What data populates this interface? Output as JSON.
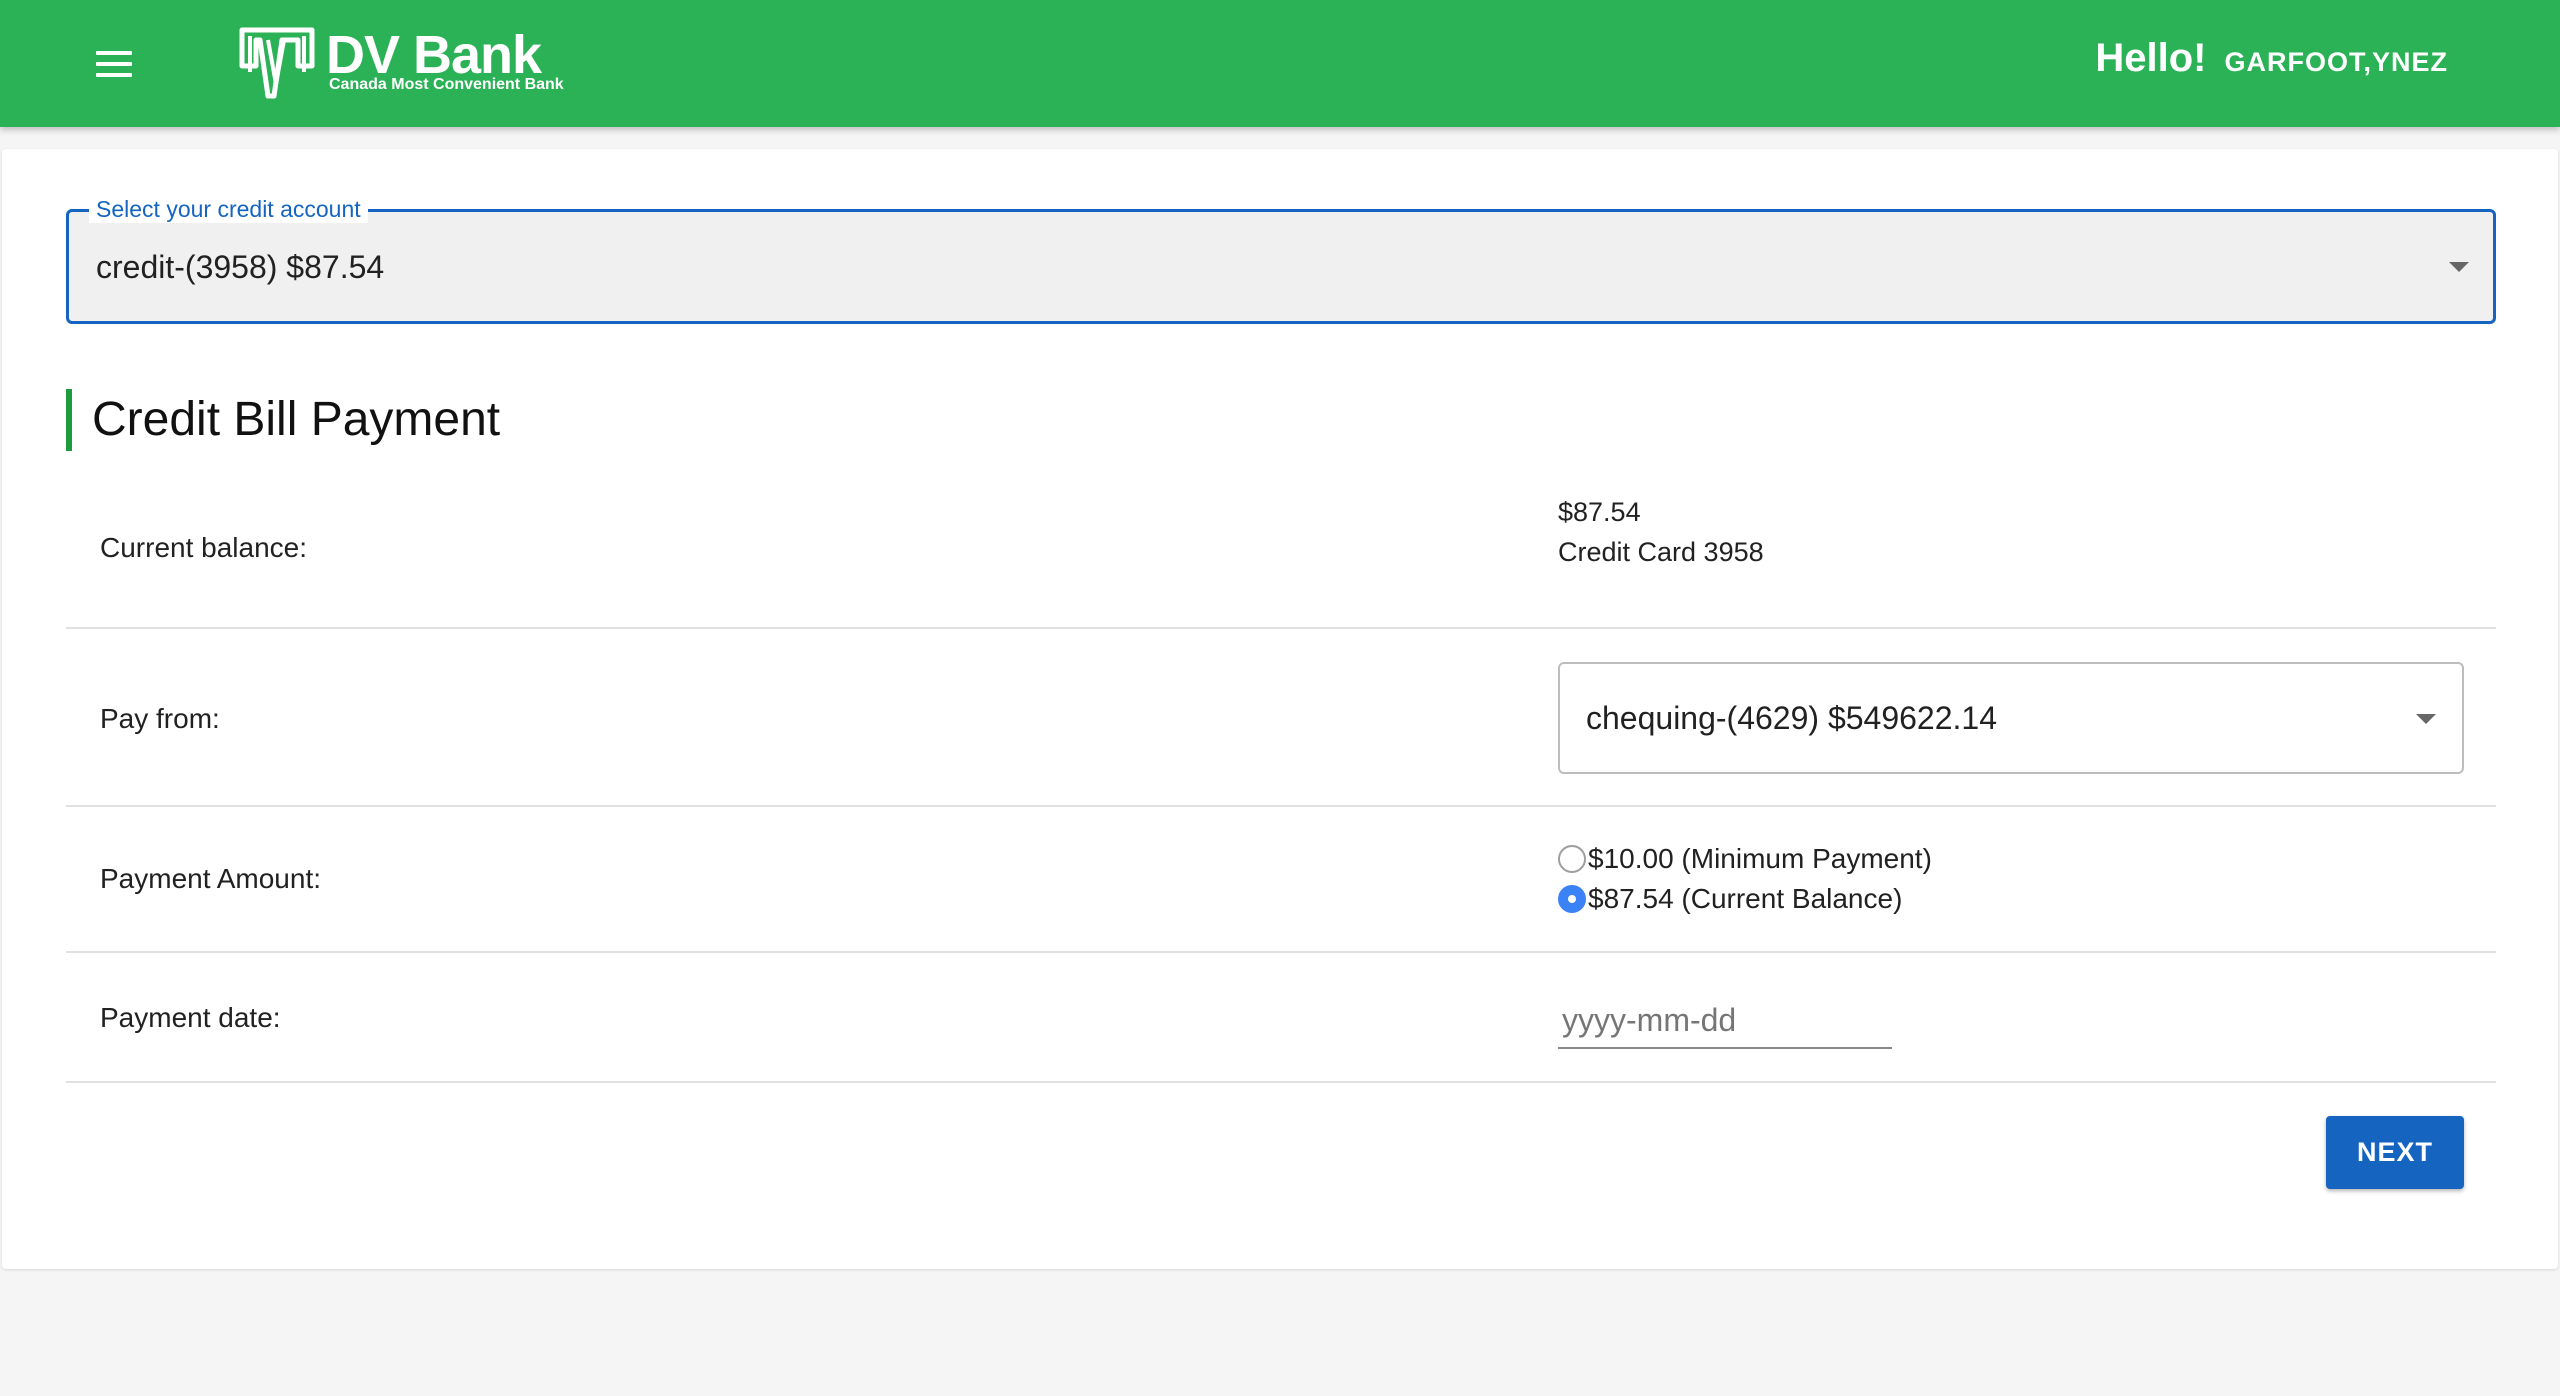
{
  "header": {
    "brand_name": "DV Bank",
    "brand_tagline": "Canada Most Convenient Bank",
    "greeting": "Hello!",
    "user_name": "GARFOOT,YNEZ",
    "bar_color": "#2bb256"
  },
  "credit_account": {
    "label": "Select your credit account",
    "selected": "credit-(3958) $87.54"
  },
  "section_title": "Credit Bill Payment",
  "rows": {
    "balance": {
      "label": "Current balance:",
      "amount": "$87.54",
      "card": "Credit Card 3958"
    },
    "pay_from": {
      "label": "Pay from:",
      "selected": "chequing-(4629) $549622.14"
    },
    "amount": {
      "label": "Payment Amount:",
      "options": [
        {
          "text": "$10.00 (Minimum Payment)",
          "checked": false
        },
        {
          "text": "$87.54 (Current Balance)",
          "checked": true
        }
      ]
    },
    "date": {
      "label": "Payment date:",
      "placeholder": "yyyy-mm-dd"
    }
  },
  "next_label": "NEXT",
  "colors": {
    "accent_blue": "#1565c0",
    "title_bar_green": "#1e9b3d",
    "radio_blue": "#3b82f6"
  }
}
